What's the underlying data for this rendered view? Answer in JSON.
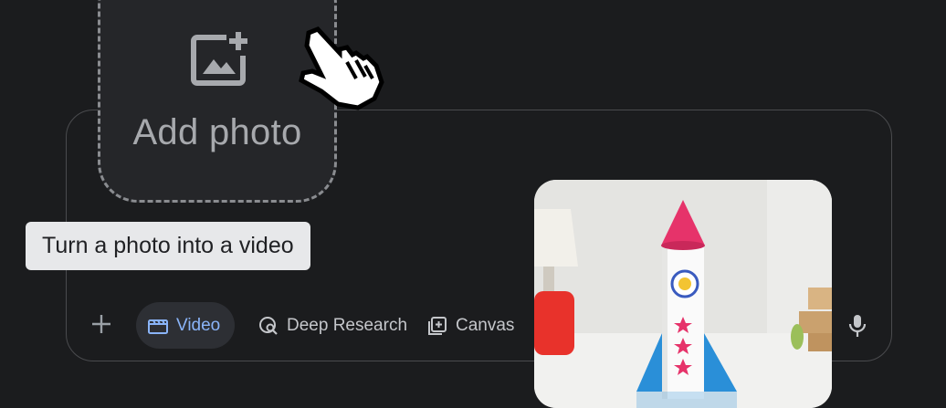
{
  "add_photo": {
    "label": "Add photo",
    "icon": "add-photo-icon"
  },
  "tooltip": {
    "text": "Turn a photo into a video"
  },
  "toolbar": {
    "plus_icon": "plus-icon",
    "video_label": "Video",
    "video_icon": "clapperboard-icon",
    "deep_research_label": "Deep Research",
    "deep_research_icon": "deep-research-icon",
    "canvas_label": "Canvas",
    "canvas_icon": "canvas-icon",
    "mic_icon": "microphone-icon"
  },
  "preview": {
    "description_icon": "rocket-photo"
  },
  "colors": {
    "background": "#1b1c1e",
    "accent": "#8ab4f8",
    "tooltip_bg": "#e7e8ea",
    "rocket_cone": "#e6336a",
    "rocket_fins": "#2a8fd8"
  }
}
